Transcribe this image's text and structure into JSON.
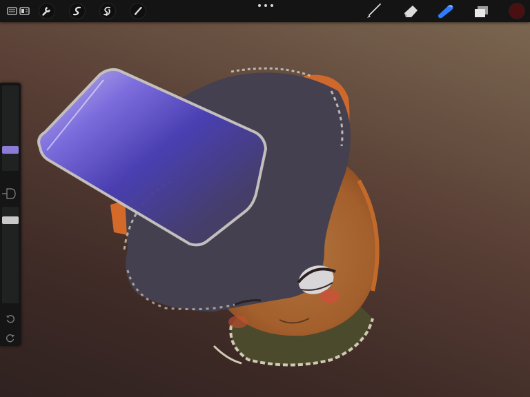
{
  "toolbar": {
    "left_tools": [
      {
        "name": "gallery-icon"
      },
      {
        "name": "layout-icon"
      },
      {
        "name": "wrench-icon"
      },
      {
        "name": "adjustments-icon"
      },
      {
        "name": "selection-icon"
      },
      {
        "name": "transform-arrow-icon"
      }
    ],
    "right_tools": [
      {
        "name": "brush-icon"
      },
      {
        "name": "smudge-icon"
      },
      {
        "name": "eraser-icon"
      },
      {
        "name": "layers-icon"
      }
    ],
    "more_icon": "ellipsis-icon",
    "current_color": "#4a0f10",
    "accent": "#2f7bff"
  },
  "sidebar": {
    "brush_size_icon": "brush-size-slider",
    "opacity_icon": "opacity-slider",
    "modify_icon": "modify-square-icon",
    "undo_icon": "undo-icon",
    "redo_icon": "redo-icon",
    "brush_size_thumb_color": "#8c7cd8",
    "opacity_thumb_color": "#c9c9c9"
  },
  "canvas": {
    "background_colors": [
      "#7a6650",
      "#5a4036",
      "#2f2220"
    ]
  }
}
